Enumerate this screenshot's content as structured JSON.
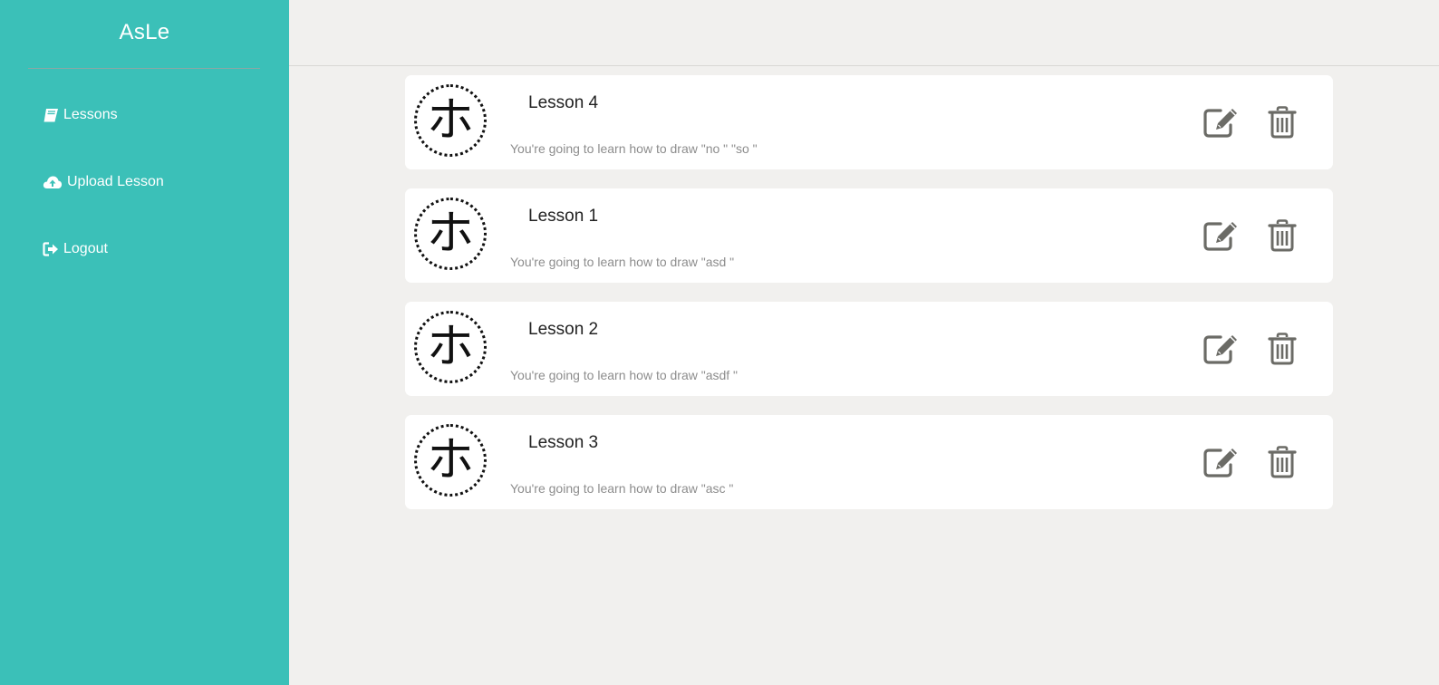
{
  "app": {
    "title": "AsLe"
  },
  "sidebar": {
    "items": [
      {
        "label": "Lessons",
        "icon": "book-icon"
      },
      {
        "label": "Upload Lesson",
        "icon": "cloud-upload-icon"
      },
      {
        "label": "Logout",
        "icon": "sign-out-icon"
      }
    ]
  },
  "lessons": [
    {
      "title": "Lesson 4",
      "description": "You're going to learn how to draw \"no \" \"so \"",
      "glyph": "ホ"
    },
    {
      "title": "Lesson 1",
      "description": "You're going to learn how to draw \"asd \"",
      "glyph": "ホ"
    },
    {
      "title": "Lesson 2",
      "description": "You're going to learn how to draw \"asdf \"",
      "glyph": "ホ"
    },
    {
      "title": "Lesson 3",
      "description": "You're going to learn how to draw \"asc \"",
      "glyph": "ホ"
    }
  ],
  "colors": {
    "sidebar": "#3bc0b8",
    "background": "#f1f0ee",
    "icon": "#6b6b66"
  }
}
